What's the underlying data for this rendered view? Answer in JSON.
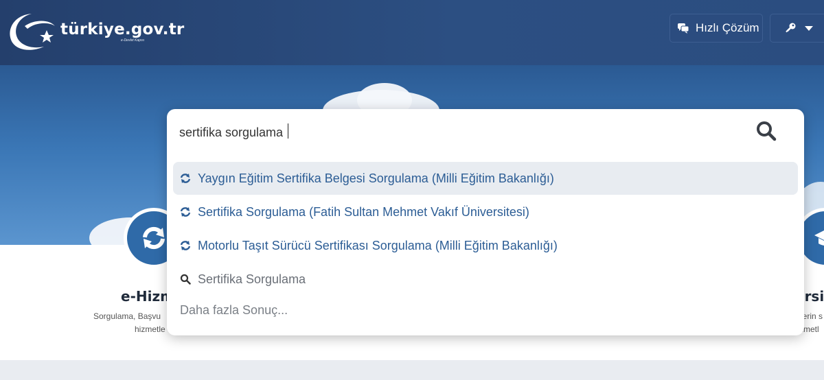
{
  "header": {
    "logo_text": "türkiye.gov.tr",
    "logo_sub": "e-Devlet Kapısı",
    "quick_solution_label": "Hızlı Çözüm"
  },
  "search": {
    "value": "sertifika sorgulama",
    "suggestions": [
      {
        "label": "Yaygın Eğitim Sertifika Belgesi Sorgulama (Milli Eğitim Bakanlığı)",
        "icon": "refresh-icon",
        "highlighted": true
      },
      {
        "label": "Sertifika Sorgulama (Fatih Sultan Mehmet Vakıf Üniversitesi)",
        "icon": "refresh-icon",
        "highlighted": false
      },
      {
        "label": "Motorlu Taşıt Sürücü Sertifikası Sorgulama (Milli Eğitim Bakanlığı)",
        "icon": "refresh-icon",
        "highlighted": false
      },
      {
        "label": "Sertifika Sorgulama",
        "icon": "search-icon",
        "highlighted": false
      }
    ],
    "more_label": "Daha fazla Sonuç..."
  },
  "cards": {
    "left": {
      "title": "e-Hizme",
      "desc_line1": "Sorgulama, Başvu",
      "desc_line2": "hizmetle"
    },
    "right": {
      "title": "ersi",
      "desc_line1": "lerin s",
      "desc_line2": "zmetl"
    }
  },
  "colors": {
    "header_bg": "#2a4a7a",
    "link": "#2c5d95",
    "accent": "#2f6aa8"
  }
}
